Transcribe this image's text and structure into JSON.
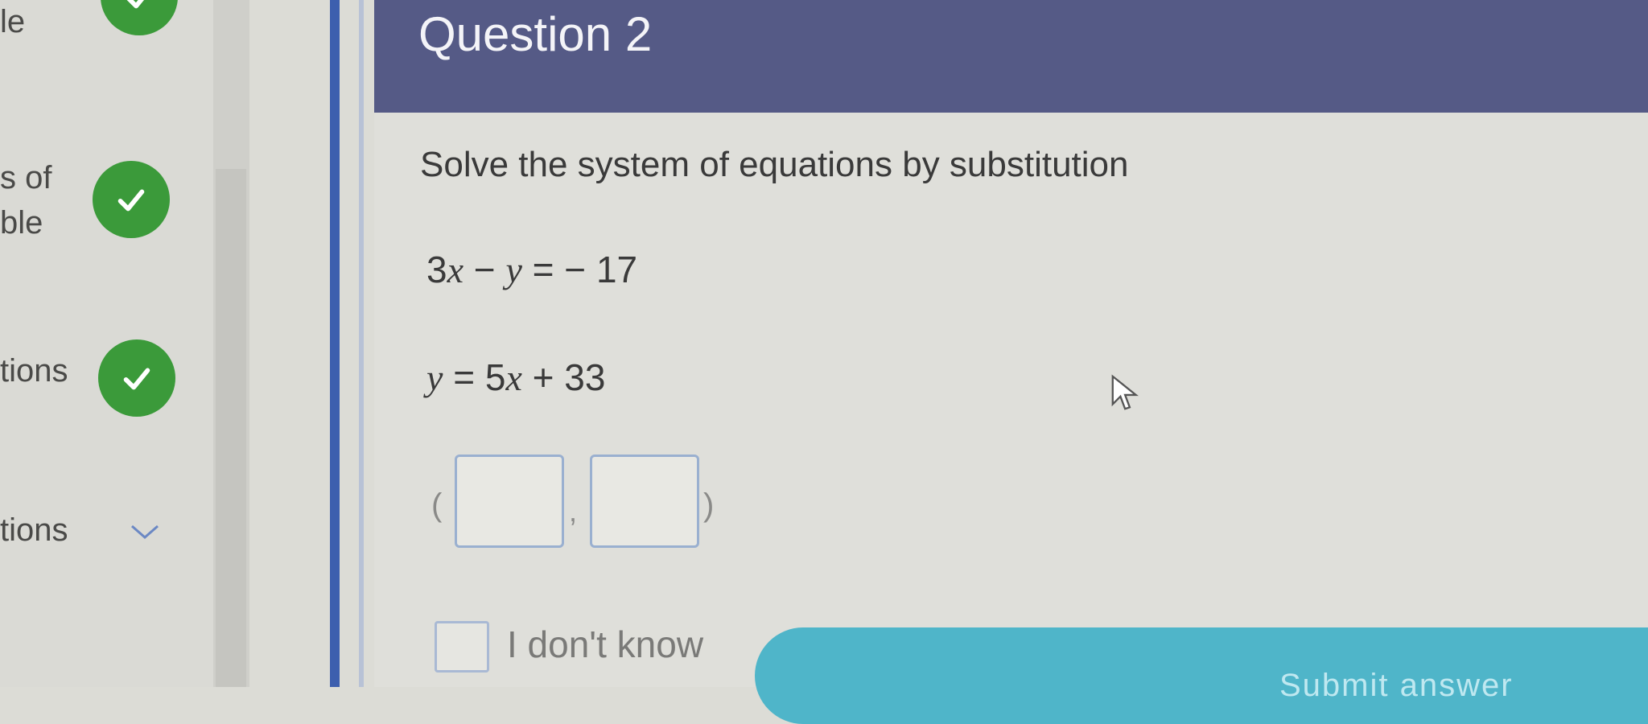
{
  "sidebar": {
    "items": [
      {
        "label": "le",
        "status": "complete"
      },
      {
        "label_line1": "s of",
        "label_line2": "ble",
        "status": "complete"
      },
      {
        "label": "tions",
        "status": "complete"
      },
      {
        "label": "tions",
        "status": "collapsed"
      }
    ]
  },
  "main": {
    "title": "Question 2",
    "prompt": "Solve the system of equations by substitution",
    "equation1": {
      "lhs_a": "3",
      "lhs_b": "x",
      "op": "−",
      "lhs_c": "y",
      "rhs": "= − 17"
    },
    "equation2": {
      "lhs": "y",
      "rhs_a": "= 5",
      "rhs_b": "x",
      "rhs_c": "+ 33"
    },
    "answer": {
      "open_paren": "(",
      "separator": ",",
      "close_paren": ")",
      "x_value": "",
      "y_value": ""
    },
    "idk_label": "I don't know",
    "submit_label": "Submit answer"
  },
  "colors": {
    "header": "#555a86",
    "check": "#3b9a3a",
    "submit": "#4fb5c9",
    "accent_blue": "#3d5fae"
  },
  "icons": [
    "check-icon",
    "chevron-down-icon",
    "mouse-pointer-icon"
  ]
}
